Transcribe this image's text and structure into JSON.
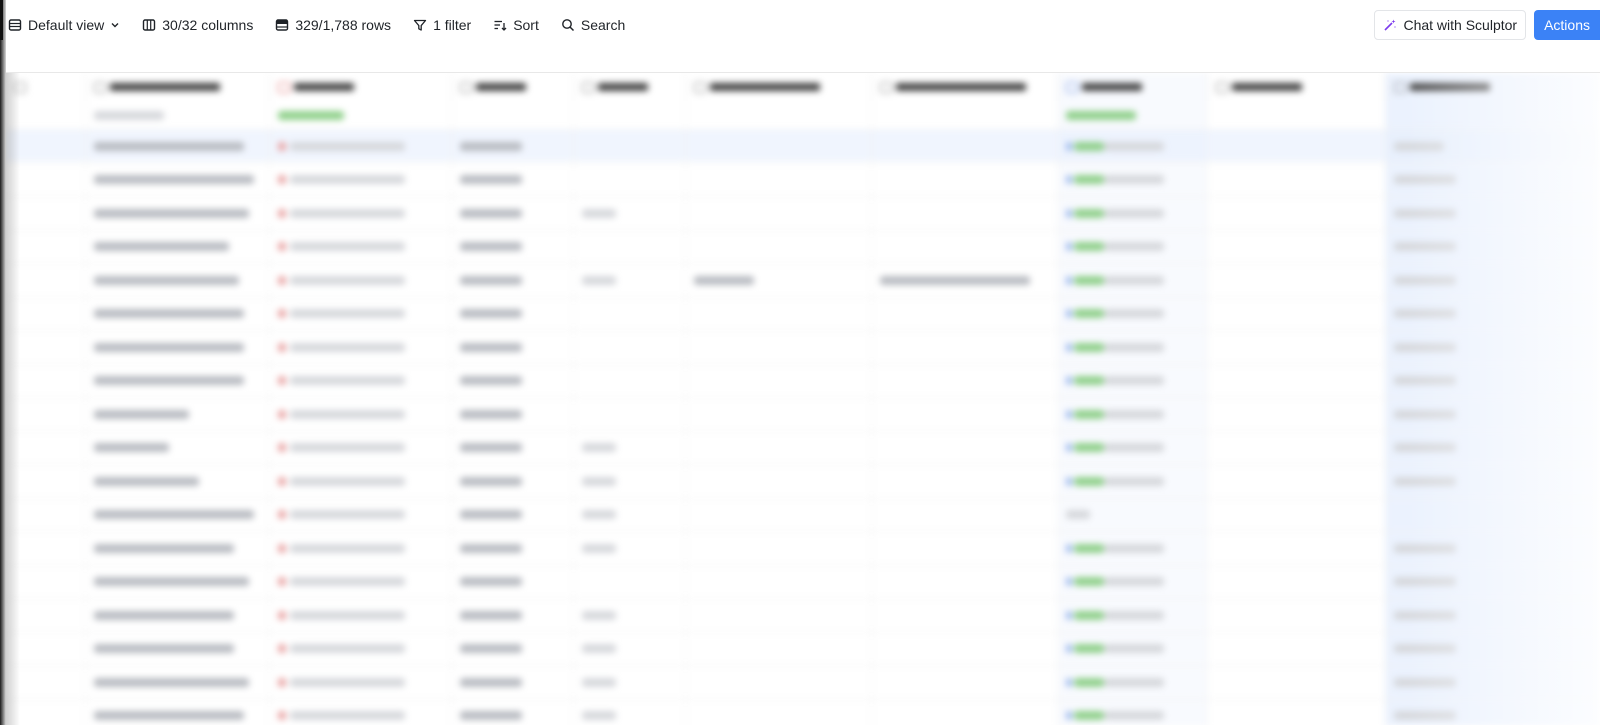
{
  "toolbar": {
    "view_label": "Default view",
    "columns_label": "30/32 columns",
    "rows_label": "329/1,788 rows",
    "filter_label": "1 filter",
    "sort_label": "Sort",
    "search_label": "Search",
    "chat_label": "Chat with Sculptor",
    "actions_label": "Actions"
  },
  "colors": {
    "accent": "#3b82f6",
    "status_green": "#8fd08a",
    "highlight_blue": "#dbe8fe"
  },
  "table": {
    "row_count_visible": 18
  }
}
